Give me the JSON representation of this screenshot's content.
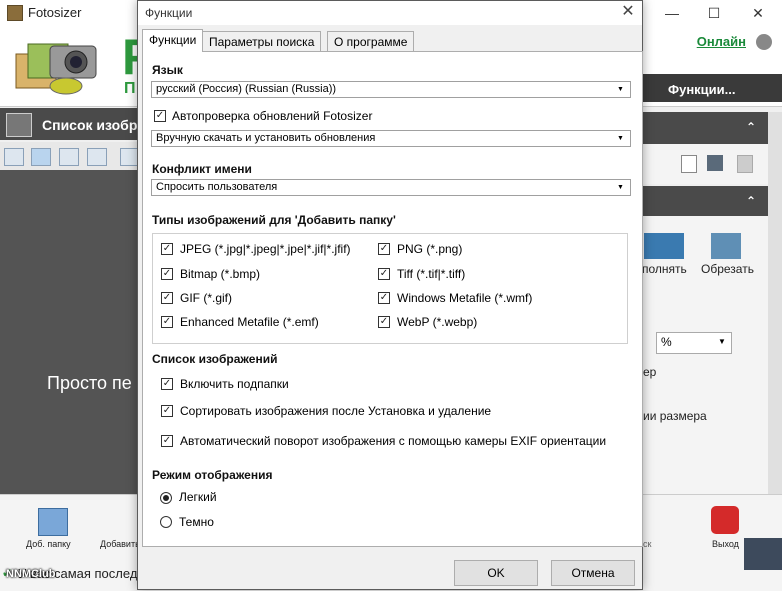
{
  "app": {
    "title": "Fotosizer",
    "online_link": "Онлайн",
    "logo_letter": "F",
    "logo_letter_2": "П",
    "left_panel_title": "Список изобр",
    "left_empty_text": "Просто пе",
    "functions_button": "Функции...",
    "right_fill_label": "полнять",
    "right_crop_label": "Обрезать",
    "right_unit_value": "%",
    "right_label_er": "ер",
    "right_label_size": "ии размера",
    "toolbar_add_folder": "Доб. папку",
    "toolbar_add": "Добавить",
    "toolbar_exit": "Выход",
    "toolbar_partial_label": "ск",
    "status_text": "У вас самая послед",
    "watermark": "NNMClub",
    "win_minimize": "—",
    "win_maximize": "☐",
    "win_close": "✕",
    "chevron": "⌃"
  },
  "dialog": {
    "title": "Функции",
    "close_glyph": "✕",
    "tabs": [
      {
        "label": "Функции",
        "active": true
      },
      {
        "label": "Параметры поиска",
        "active": false
      },
      {
        "label": "О программе",
        "active": false
      }
    ],
    "language": {
      "title": "Язык",
      "value": "русский (Россия) (Russian (Russia))"
    },
    "updates": {
      "checkbox_label": "Автопроверка обновлений Fotosizer",
      "checked": true,
      "mode_value": "Вручную скачать и установить обновления"
    },
    "conflict": {
      "title": "Конфликт имени",
      "value": "Спросить пользователя"
    },
    "image_types": {
      "title": "Типы изображений для 'Добавить папку'",
      "left": [
        {
          "label": "JPEG (*.jpg|*.jpeg|*.jpe|*.jif|*.jfif)",
          "checked": true
        },
        {
          "label": "Bitmap (*.bmp)",
          "checked": true
        },
        {
          "label": "GIF (*.gif)",
          "checked": true
        },
        {
          "label": "Enhanced Metafile (*.emf)",
          "checked": true
        }
      ],
      "right": [
        {
          "label": "PNG (*.png)",
          "checked": true
        },
        {
          "label": "Tiff (*.tif|*.tiff)",
          "checked": true
        },
        {
          "label": "Windows Metafile (*.wmf)",
          "checked": true
        },
        {
          "label": "WebP (*.webp)",
          "checked": true
        }
      ]
    },
    "image_list": {
      "title": "Список изображений",
      "options": [
        {
          "label": "Включить подпапки",
          "checked": true
        },
        {
          "label": "Сортировать изображения после Установка и удаление",
          "checked": true
        },
        {
          "label": "Автоматический поворот изображения с помощью камеры EXIF ориентации",
          "checked": true
        }
      ]
    },
    "display_mode": {
      "title": "Режим отображения",
      "options": [
        {
          "label": "Легкий",
          "selected": true
        },
        {
          "label": "Темно",
          "selected": false
        }
      ]
    },
    "ok_label": "OK",
    "cancel_label": "Отмена"
  },
  "colors": {
    "accent_green": "#2e9a3e",
    "panel_dark": "#4a4a4a"
  }
}
